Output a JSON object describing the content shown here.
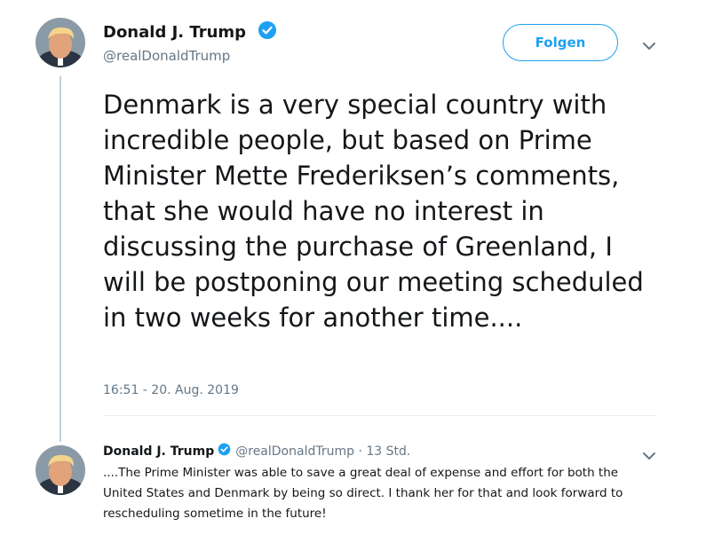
{
  "main_tweet": {
    "author_name": "Donald J. Trump",
    "handle": "@realDonaldTrump",
    "follow_label": "Folgen",
    "text": "Denmark is a very special country with incredible people, but based on Prime Minister Mette Frederiksen’s comments, that she would have no interest in discussing the purchase of Greenland, I will be postponing our meeting scheduled in two weeks for another time....",
    "timestamp": "16:51 - 20. Aug. 2019"
  },
  "reply_tweet": {
    "author_name": "Donald J. Trump",
    "handle": "@realDonaldTrump",
    "separator": " · ",
    "time_ago": "13 Std.",
    "text": "....The Prime Minister was able to save a great deal of expense and effort for both the United States and Denmark by being so direct. I thank her for that and look forward to rescheduling sometime in the future!"
  },
  "icons": {
    "verified": "verified-badge-icon",
    "caret": "chevron-down-icon",
    "avatar": "profile-avatar"
  },
  "colors": {
    "accent": "#1da1f2",
    "text_primary": "#14171a",
    "text_secondary": "#657786",
    "thread_line": "#c4cfd6"
  }
}
